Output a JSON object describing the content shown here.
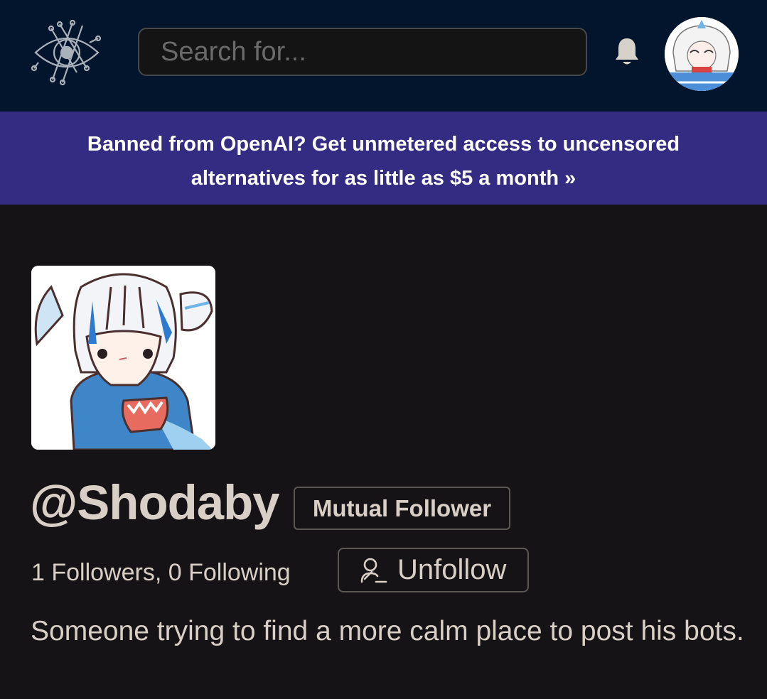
{
  "header": {
    "logo_icon": "eye-circuit-logo",
    "search": {
      "placeholder": "Search for...",
      "value": ""
    },
    "notification_icon": "bell-icon",
    "user_avatar_icon": "user-avatar"
  },
  "banner": {
    "line1": "Banned from OpenAI? Get unmetered access to uncensored",
    "line2": "alternatives for as little as $5 a month »"
  },
  "profile": {
    "username": "@Shodaby",
    "badge": "Mutual Follower",
    "follow_stats": "1 Followers, 0 Following",
    "unfollow_label": "Unfollow",
    "unfollow_icon": "user-minus-icon",
    "bio": "Someone trying to find a more calm place to post his bots."
  },
  "colors": {
    "topbar": "#02152c",
    "banner": "#342b83",
    "page_bg": "#161316",
    "text": "#d8cfc6"
  }
}
